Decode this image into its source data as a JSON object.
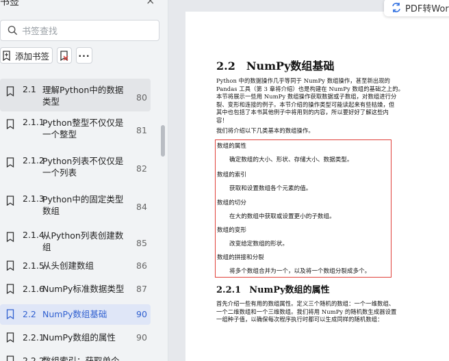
{
  "sidebar": {
    "title": "书签",
    "close": "×",
    "search_placeholder": "书签查找",
    "add_bookmark_label": "添加书签",
    "more_label": "···",
    "items": [
      {
        "num": "2.1",
        "title": "理解Python中的数据类型",
        "page": "80"
      },
      {
        "num": "2.1.1",
        "title": "Python整型不仅仅是一个整型",
        "page": "81"
      },
      {
        "num": "2.1.2",
        "title": "Python列表不仅仅是一个列表",
        "page": "82"
      },
      {
        "num": "2.1.3",
        "title": "Python中的固定类型数组",
        "page": "84"
      },
      {
        "num": "2.1.4",
        "title": "从Python列表创建数组",
        "page": "85"
      },
      {
        "num": "2.1.5",
        "title": "从头创建数组",
        "page": "86"
      },
      {
        "num": "2.1.6",
        "title": "NumPy标准数据类型",
        "page": "87"
      },
      {
        "num": "2.2",
        "title": "NumPy数组基础",
        "page": "90"
      },
      {
        "num": "2.2.1",
        "title": "NumPy数组的属性",
        "page": "90"
      },
      {
        "num": "2.2.2",
        "title": "数组索引：获取单个",
        "page": ""
      }
    ]
  },
  "pdf_to_word": "PDF转Word",
  "document": {
    "section_num": "2.2",
    "section_title": "NumPy数组基础",
    "intro_lines": [
      "Python 中的数据操作几乎等同于 NumPy 数组操作，甚至新出现的",
      "Pandas 工具（第 3 章将介绍）也是构建在 NumPy 数组的基础之上的。",
      "本节将展示一些用 NumPy 数组操作获取数据或子数组，对数组进行分",
      "裂、变形和连接的例子。本节介绍的操作类型可能读起来有些枯燥，但",
      "其中也包括了本书其他例子中将用到的内容，所以要好好了解这些内",
      "容！"
    ],
    "lead": "我们将介绍以下几类基本的数组操作。",
    "defs": [
      {
        "term": "数组的属性",
        "desc": "确定数组的大小、形状、存储大小、数据类型。"
      },
      {
        "term": "数组的索引",
        "desc": "获取和设置数组各个元素的值。"
      },
      {
        "term": "数组的切分",
        "desc": "在大的数组中获取或设置更小的子数组。"
      },
      {
        "term": "数组的变形",
        "desc": "改变给定数组的形状。"
      },
      {
        "term": "数组的拼接和分裂",
        "desc": "将多个数组合并为一个，以及将一个数组分裂成多个。"
      }
    ],
    "sub_num": "2.2.1",
    "sub_title": "NumPy数组的属性",
    "para2_lines": [
      "首先介绍一些有用的数组属性。定义三个随机的数组：一个一维数组、",
      "一个二维数组和一个三维数组。我们将用 NumPy 的随机数生成器设置",
      "一组种子值，以确保每次程序执行时都可以生成同样的随机数组："
    ]
  }
}
